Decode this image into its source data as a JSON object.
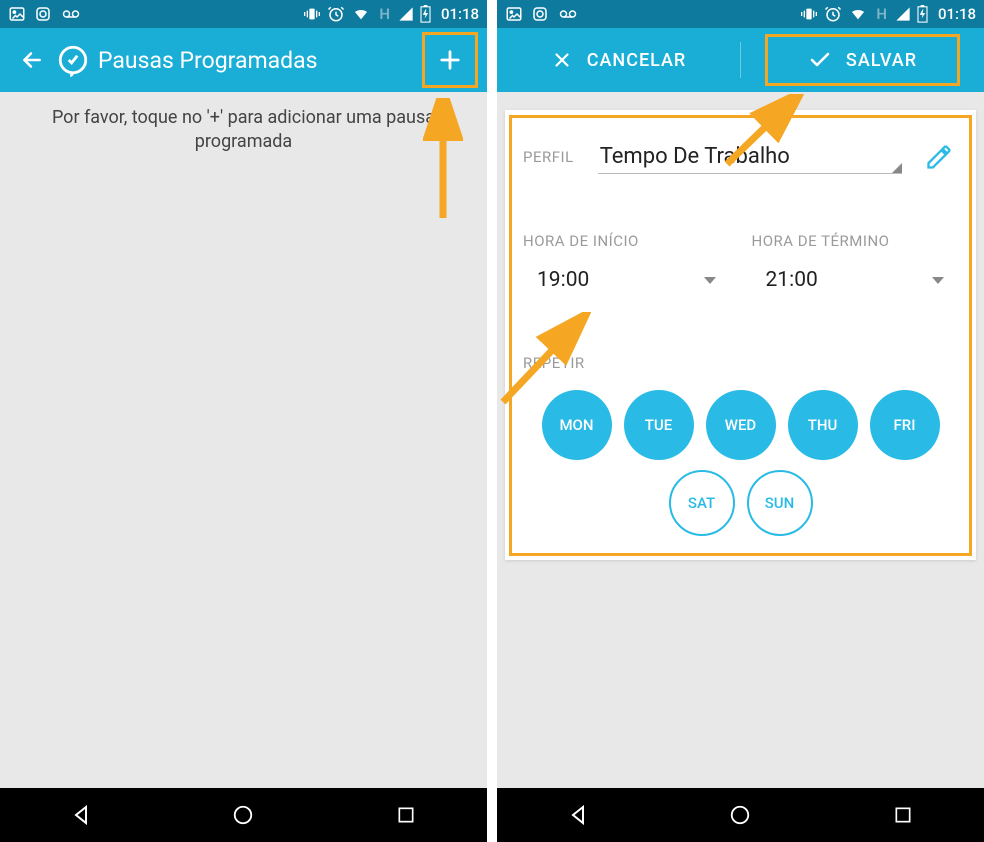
{
  "status_bar": {
    "time": "01:18",
    "signal_type": "H"
  },
  "screen1": {
    "title": "Pausas Programadas",
    "empty_message": "Por favor, toque no '+' para adicionar uma pausa programada"
  },
  "screen2": {
    "cancel_label": "CANCELAR",
    "save_label": "SALVAR",
    "profile_label": "PERFIL",
    "profile_value": "Tempo De Trabalho",
    "start_label": "HORA DE INÍCIO",
    "start_value": "19:00",
    "end_label": "HORA DE TÉRMINO",
    "end_value": "21:00",
    "repeat_label": "REPETIR",
    "days": [
      {
        "label": "MON",
        "active": true
      },
      {
        "label": "TUE",
        "active": true
      },
      {
        "label": "WED",
        "active": true
      },
      {
        "label": "THU",
        "active": true
      },
      {
        "label": "FRI",
        "active": true
      },
      {
        "label": "SAT",
        "active": false
      },
      {
        "label": "SUN",
        "active": false
      }
    ]
  },
  "colors": {
    "primary": "#1aaed7",
    "primary_dark": "#0d7a9e",
    "accent_highlight": "#f5a623"
  }
}
